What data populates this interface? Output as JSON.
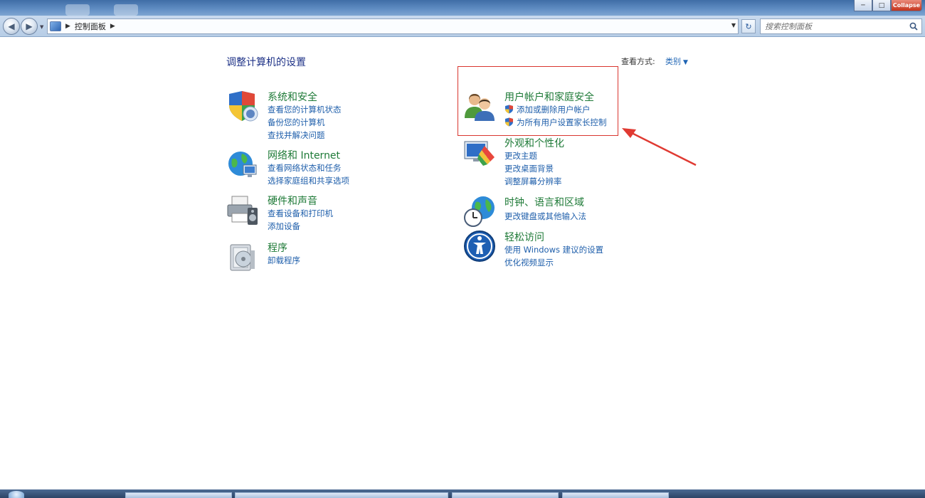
{
  "window": {
    "close_label": "Collapse"
  },
  "toolbar": {
    "breadcrumb": [
      "控制面板"
    ],
    "search_placeholder": "搜索控制面板"
  },
  "header": {
    "heading": "调整计算机的设置",
    "view_by_label": "查看方式:",
    "view_by_value": "类别"
  },
  "categories": [
    {
      "title": "系统和安全",
      "icon": "shield-computer-icon",
      "links": [
        {
          "label": "查看您的计算机状态"
        },
        {
          "label": "备份您的计算机"
        },
        {
          "label": "查找并解决问题"
        }
      ]
    },
    {
      "title": "网络和 Internet",
      "icon": "network-globe-icon",
      "links": [
        {
          "label": "查看网络状态和任务"
        },
        {
          "label": "选择家庭组和共享选项"
        }
      ]
    },
    {
      "title": "硬件和声音",
      "icon": "printer-speaker-icon",
      "links": [
        {
          "label": "查看设备和打印机"
        },
        {
          "label": "添加设备"
        }
      ]
    },
    {
      "title": "程序",
      "icon": "programs-disk-icon",
      "links": [
        {
          "label": "卸载程序"
        }
      ]
    },
    {
      "title": "用户帐户和家庭安全",
      "icon": "users-icon",
      "links": [
        {
          "label": "添加或删除用户帐户",
          "icon": "uac-shield-icon"
        },
        {
          "label": "为所有用户设置家长控制",
          "icon": "uac-shield-icon"
        }
      ]
    },
    {
      "title": "外观和个性化",
      "icon": "appearance-icon",
      "links": [
        {
          "label": "更改主题"
        },
        {
          "label": "更改桌面背景"
        },
        {
          "label": "调整屏幕分辨率"
        }
      ]
    },
    {
      "title": "时钟、语言和区域",
      "icon": "clock-globe-icon",
      "links": [
        {
          "label": "更改键盘或其他输入法"
        }
      ]
    },
    {
      "title": "轻松访问",
      "icon": "ease-of-access-icon",
      "links": [
        {
          "label": "使用 Windows 建议的设置"
        },
        {
          "label": "优化视频显示"
        }
      ]
    }
  ],
  "colors": {
    "category_title": "#1e7a37",
    "link": "#1f5fab",
    "heading": "#1e3287",
    "highlight_box": "#d9362f"
  }
}
